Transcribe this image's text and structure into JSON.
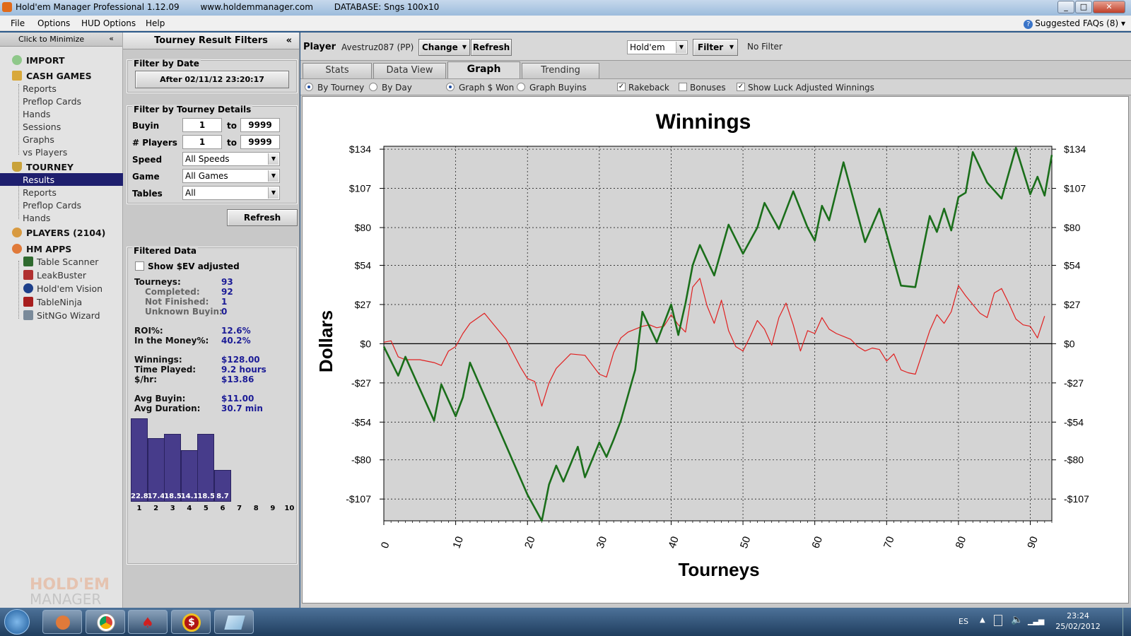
{
  "window": {
    "app_title": "Hold'em Manager Professional 1.12.09",
    "website": "www.holdemmanager.com",
    "database": "DATABASE: Sngs 100x10"
  },
  "menu": {
    "items": [
      "File",
      "Options",
      "HUD Options",
      "Help"
    ],
    "faq": "Suggested FAQs (8)"
  },
  "nav": {
    "minimize": "Click to Minimize",
    "import": "IMPORT",
    "cash_games": "CASH GAMES",
    "cash_items": [
      "Reports",
      "Preflop Cards",
      "Hands",
      "Sessions",
      "Graphs",
      "vs Players"
    ],
    "tourney": "TOURNEY",
    "tourney_items": [
      "Results",
      "Reports",
      "Preflop Cards",
      "Hands"
    ],
    "players": "PLAYERS (2104)",
    "hm_apps": "HM APPS",
    "apps": [
      "Table Scanner",
      "LeakBuster",
      "Hold'em Vision",
      "TableNinja",
      "SitNGo Wizard"
    ],
    "brand_line1": "HOLD'EM",
    "brand_line2": "MANAGER"
  },
  "filters": {
    "title": "Tourney Result Filters",
    "by_date": "Filter by Date",
    "date_button": "After 02/11/12 23:20:17",
    "by_details": "Filter by Tourney Details",
    "buyin_label": "Buyin",
    "buyin_from": "1",
    "buyin_to": "9999",
    "players_label": "# Players",
    "players_from": "1",
    "players_to": "9999",
    "to": "to",
    "speed_label": "Speed",
    "speed_value": "All Speeds",
    "game_label": "Game",
    "game_value": "All Games",
    "tables_label": "Tables",
    "tables_value": "All",
    "refresh": "Refresh"
  },
  "filtered": {
    "title": "Filtered Data",
    "show_ev": "Show $EV adjusted",
    "tourneys_label": "Tourneys:",
    "tourneys": "93",
    "completed_label": "Completed:",
    "completed": "92",
    "not_finished_label": "Not Finished:",
    "not_finished": "1",
    "unknown_label": "Unknown Buyin:",
    "unknown": "0",
    "roi_label": "ROI%:",
    "roi": "12.6%",
    "itm_label": "In the Money%:",
    "itm": "40.2%",
    "winnings_label": "Winnings:",
    "winnings": "$128.00",
    "time_label": "Time Played:",
    "time": "9.2 hours",
    "hr_label": "$/hr:",
    "hr": "$13.86",
    "avgbuyin_label": "Avg Buyin:",
    "avgbuyin": "$11.00",
    "avgdur_label": "Avg Duration:",
    "avgdur": "30.7 min",
    "finish_hist": {
      "positions": [
        "1",
        "2",
        "3",
        "4",
        "5",
        "6",
        "7",
        "8",
        "9",
        "10"
      ],
      "values": [
        22.8,
        17.4,
        18.5,
        14.1,
        18.5,
        8.7,
        null,
        null,
        null,
        null
      ],
      "labels": [
        "22.8",
        "17.4",
        "18.5",
        "14.1",
        "18.5",
        "8.7",
        "",
        "",
        "",
        ""
      ]
    }
  },
  "player": {
    "label": "Player",
    "name": "Avestruz087 (PP)",
    "change": "Change",
    "refresh": "Refresh",
    "game": "Hold'em",
    "filter": "Filter",
    "no_filter": "No Filter"
  },
  "tabs": [
    "Stats",
    "Data View",
    "Graph",
    "Trending"
  ],
  "active_tab": "Graph",
  "options": {
    "by_tourney": "By Tourney",
    "by_day": "By Day",
    "graph_won": "Graph $ Won",
    "graph_buyins": "Graph Buyins",
    "rakeback": "Rakeback",
    "bonuses": "Bonuses",
    "luck": "Show Luck Adjusted Winnings",
    "check_mark": "✓"
  },
  "taskbar": {
    "lang": "ES",
    "time": "23:24",
    "date": "25/02/2012"
  },
  "chart_data": {
    "type": "line",
    "title": "Winnings",
    "xlabel": "Tourneys",
    "ylabel": "Dollars",
    "xlim": [
      0,
      93
    ],
    "ylim": [
      -122,
      136
    ],
    "yticks": [
      134,
      107,
      80,
      54,
      27,
      0,
      -27,
      -54,
      -80,
      -107
    ],
    "ytick_labels": [
      "$134",
      "$107",
      "$80",
      "$54",
      "$27",
      "$0",
      "-$27",
      "-$54",
      "-$80",
      "-$107"
    ],
    "xticks": [
      0,
      10,
      20,
      30,
      40,
      50,
      60,
      70,
      80,
      90
    ],
    "grid": true,
    "colors": {
      "winnings": "#1a6e1a",
      "luck": "#e02020"
    },
    "series": [
      {
        "key": "winnings",
        "points": [
          [
            0,
            -2
          ],
          [
            2,
            -22
          ],
          [
            3,
            -9
          ],
          [
            7,
            -53
          ],
          [
            8,
            -28
          ],
          [
            10,
            -50
          ],
          [
            11,
            -37
          ],
          [
            12,
            -13
          ],
          [
            20,
            -104
          ],
          [
            22,
            -122
          ],
          [
            23,
            -97
          ],
          [
            24,
            -84
          ],
          [
            25,
            -95
          ],
          [
            27,
            -71
          ],
          [
            28,
            -92
          ],
          [
            30,
            -68
          ],
          [
            31,
            -78
          ],
          [
            32,
            -66
          ],
          [
            33,
            -53
          ],
          [
            35,
            -18
          ],
          [
            36,
            22
          ],
          [
            38,
            1
          ],
          [
            40,
            27
          ],
          [
            41,
            6
          ],
          [
            42,
            28
          ],
          [
            43,
            54
          ],
          [
            44,
            68
          ],
          [
            46,
            47
          ],
          [
            48,
            82
          ],
          [
            50,
            62
          ],
          [
            52,
            80
          ],
          [
            53,
            97
          ],
          [
            55,
            79
          ],
          [
            57,
            105
          ],
          [
            59,
            80
          ],
          [
            60,
            71
          ],
          [
            61,
            95
          ],
          [
            62,
            85
          ],
          [
            64,
            125
          ],
          [
            67,
            70
          ],
          [
            69,
            93
          ],
          [
            72,
            40
          ],
          [
            74,
            39
          ],
          [
            76,
            88
          ],
          [
            77,
            77
          ],
          [
            78,
            93
          ],
          [
            79,
            78
          ],
          [
            80,
            101
          ],
          [
            81,
            104
          ],
          [
            82,
            132
          ],
          [
            84,
            111
          ],
          [
            86,
            100
          ],
          [
            88,
            135
          ],
          [
            90,
            103
          ],
          [
            91,
            115
          ],
          [
            92,
            102
          ],
          [
            93,
            130
          ]
        ]
      },
      {
        "key": "luck",
        "points": [
          [
            0,
            1
          ],
          [
            1,
            2
          ],
          [
            2,
            -9
          ],
          [
            3,
            -11
          ],
          [
            5,
            -11
          ],
          [
            7,
            -13
          ],
          [
            8,
            -15
          ],
          [
            9,
            -5
          ],
          [
            10,
            -2
          ],
          [
            11,
            7
          ],
          [
            12,
            14
          ],
          [
            14,
            21
          ],
          [
            15,
            15
          ],
          [
            17,
            3
          ],
          [
            19,
            -16
          ],
          [
            20,
            -24
          ],
          [
            21,
            -26
          ],
          [
            22,
            -43
          ],
          [
            23,
            -27
          ],
          [
            24,
            -17
          ],
          [
            26,
            -7
          ],
          [
            28,
            -8
          ],
          [
            30,
            -21
          ],
          [
            31,
            -23
          ],
          [
            32,
            -6
          ],
          [
            33,
            4
          ],
          [
            34,
            8
          ],
          [
            35,
            10
          ],
          [
            36,
            12
          ],
          [
            37,
            13
          ],
          [
            38,
            11
          ],
          [
            39,
            12
          ],
          [
            40,
            20
          ],
          [
            41,
            13
          ],
          [
            42,
            8
          ],
          [
            43,
            39
          ],
          [
            44,
            45
          ],
          [
            45,
            26
          ],
          [
            46,
            14
          ],
          [
            47,
            30
          ],
          [
            48,
            9
          ],
          [
            49,
            -2
          ],
          [
            50,
            -5
          ],
          [
            51,
            5
          ],
          [
            52,
            16
          ],
          [
            53,
            10
          ],
          [
            54,
            -1
          ],
          [
            55,
            18
          ],
          [
            56,
            28
          ],
          [
            57,
            13
          ],
          [
            58,
            -5
          ],
          [
            59,
            9
          ],
          [
            60,
            7
          ],
          [
            61,
            18
          ],
          [
            62,
            10
          ],
          [
            63,
            7
          ],
          [
            64,
            5
          ],
          [
            65,
            3
          ],
          [
            66,
            -2
          ],
          [
            67,
            -5
          ],
          [
            68,
            -3
          ],
          [
            69,
            -4
          ],
          [
            70,
            -12
          ],
          [
            71,
            -7
          ],
          [
            72,
            -18
          ],
          [
            73,
            -20
          ],
          [
            74,
            -21
          ],
          [
            75,
            -6
          ],
          [
            76,
            9
          ],
          [
            77,
            20
          ],
          [
            78,
            14
          ],
          [
            79,
            22
          ],
          [
            80,
            40
          ],
          [
            81,
            33
          ],
          [
            82,
            27
          ],
          [
            83,
            21
          ],
          [
            84,
            18
          ],
          [
            85,
            35
          ],
          [
            86,
            38
          ],
          [
            87,
            28
          ],
          [
            88,
            17
          ],
          [
            89,
            13
          ],
          [
            90,
            12
          ],
          [
            91,
            4
          ],
          [
            92,
            19
          ]
        ]
      }
    ]
  }
}
